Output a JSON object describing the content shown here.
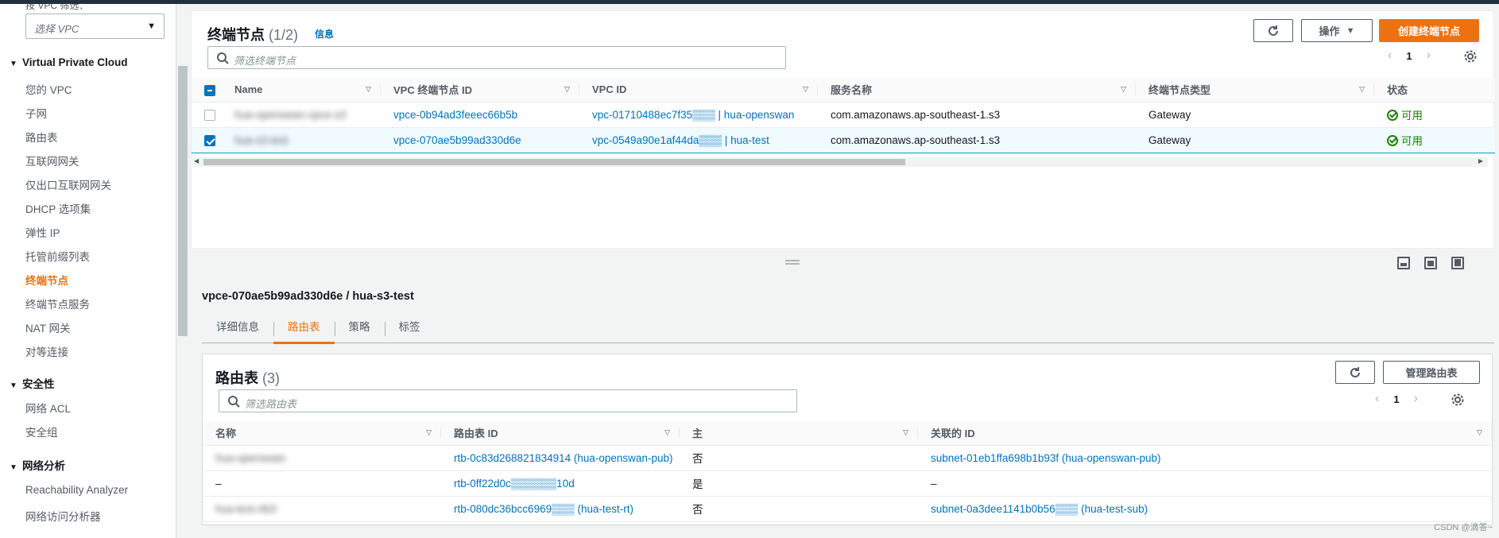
{
  "sidebar": {
    "filter_label": "按 VPC 筛选：",
    "vpc_select_placeholder": "选择 VPC",
    "sections": [
      {
        "title": "Virtual Private Cloud",
        "items": [
          "您的 VPC",
          "子网",
          "路由表",
          "互联网网关",
          "仅出口互联网网关",
          "DHCP 选项集",
          "弹性 IP",
          "托管前缀列表",
          "终端节点",
          "终端节点服务",
          "NAT 网关",
          "对等连接"
        ]
      },
      {
        "title": "安全性",
        "items": [
          "网络 ACL",
          "安全组"
        ]
      },
      {
        "title": "网络分析",
        "items": [
          "Reachability Analyzer",
          "网络访问分析器"
        ]
      }
    ],
    "active_item": "终端节点"
  },
  "endpoints": {
    "title": "终端节点",
    "count": "(1/2)",
    "info_link": "信息",
    "refresh_icon": "refresh-icon",
    "actions_label": "操作",
    "create_label": "创建终端节点",
    "search_placeholder": "筛选终端节点",
    "page": "1",
    "columns": [
      "Name",
      "VPC 终端节点 ID",
      "VPC ID",
      "服务名称",
      "终端节点类型",
      "状态"
    ],
    "rows": [
      {
        "name": "hua-openswan-vpce-s3",
        "id": "vpce-0b94ad3feeec66b5b",
        "vpc": "vpc-01710488ec7f35▒▒▒ | hua-openswan",
        "service": "com.amazonaws.ap-southeast-1.s3",
        "type": "Gateway",
        "status": "可用",
        "selected": false
      },
      {
        "name": "hua-s3-test",
        "id": "vpce-070ae5b99ad330d6e",
        "vpc": "vpc-0549a90e1af44da▒▒▒ | hua-test",
        "service": "com.amazonaws.ap-southeast-1.s3",
        "type": "Gateway",
        "status": "可用",
        "selected": true
      }
    ]
  },
  "detail": {
    "title": "vpce-070ae5b99ad330d6e / hua-s3-test",
    "tabs": [
      "详细信息",
      "路由表",
      "策略",
      "标签"
    ],
    "active_tab": "路由表"
  },
  "route_tables": {
    "title": "路由表",
    "count": "(3)",
    "manage_label": "管理路由表",
    "search_placeholder": "筛选路由表",
    "page": "1",
    "columns": [
      "名称",
      "路由表 ID",
      "主",
      "关联的 ID"
    ],
    "rows": [
      {
        "name": "hua-openswan",
        "id": "rtb-0c83d268821834914 (hua-openswan-pub)",
        "main": "否",
        "assoc": "subnet-01eb1ffa698b1b93f (hua-openswan-pub)"
      },
      {
        "name": "–",
        "id": "rtb-0ff22d0c▒▒▒▒▒▒10d",
        "main": "是",
        "assoc": "–"
      },
      {
        "name": "hua-test-rtb3",
        "id": "rtb-080dc36bcc6969▒▒▒ (hua-test-rt)",
        "main": "否",
        "assoc": "subnet-0a3dee1141b0b56▒▒▒ (hua-test-sub)"
      }
    ]
  },
  "watermark": "CSDN @滴答~",
  "colors": {
    "accent": "#ec7211",
    "link": "#0073bb",
    "success": "#1d8102",
    "topbar": "#232f3e"
  }
}
